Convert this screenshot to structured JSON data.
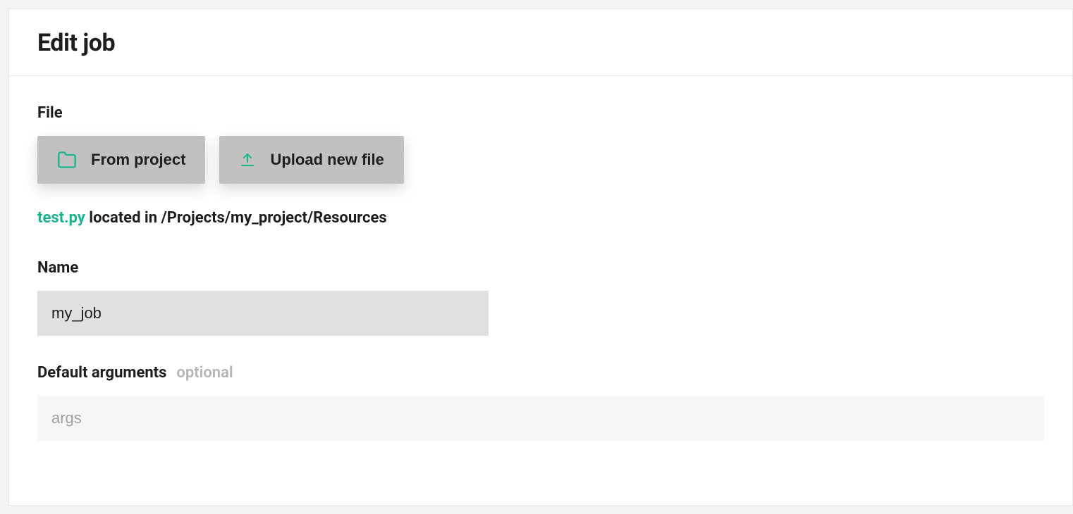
{
  "header": {
    "title": "Edit job"
  },
  "file_section": {
    "label": "File",
    "from_project_label": "From project",
    "upload_label": "Upload new file",
    "selected_filename": "test.py",
    "location_text": "located in /Projects/my_project/Resources"
  },
  "name_section": {
    "label": "Name",
    "value": "my_job"
  },
  "args_section": {
    "label": "Default arguments",
    "optional_tag": "optional",
    "placeholder": "args",
    "value": ""
  },
  "colors": {
    "accent": "#1bb48f",
    "button_bg": "#c1c1c1",
    "input_bg": "#e0e0e0",
    "light_input_bg": "#f6f6f6"
  }
}
